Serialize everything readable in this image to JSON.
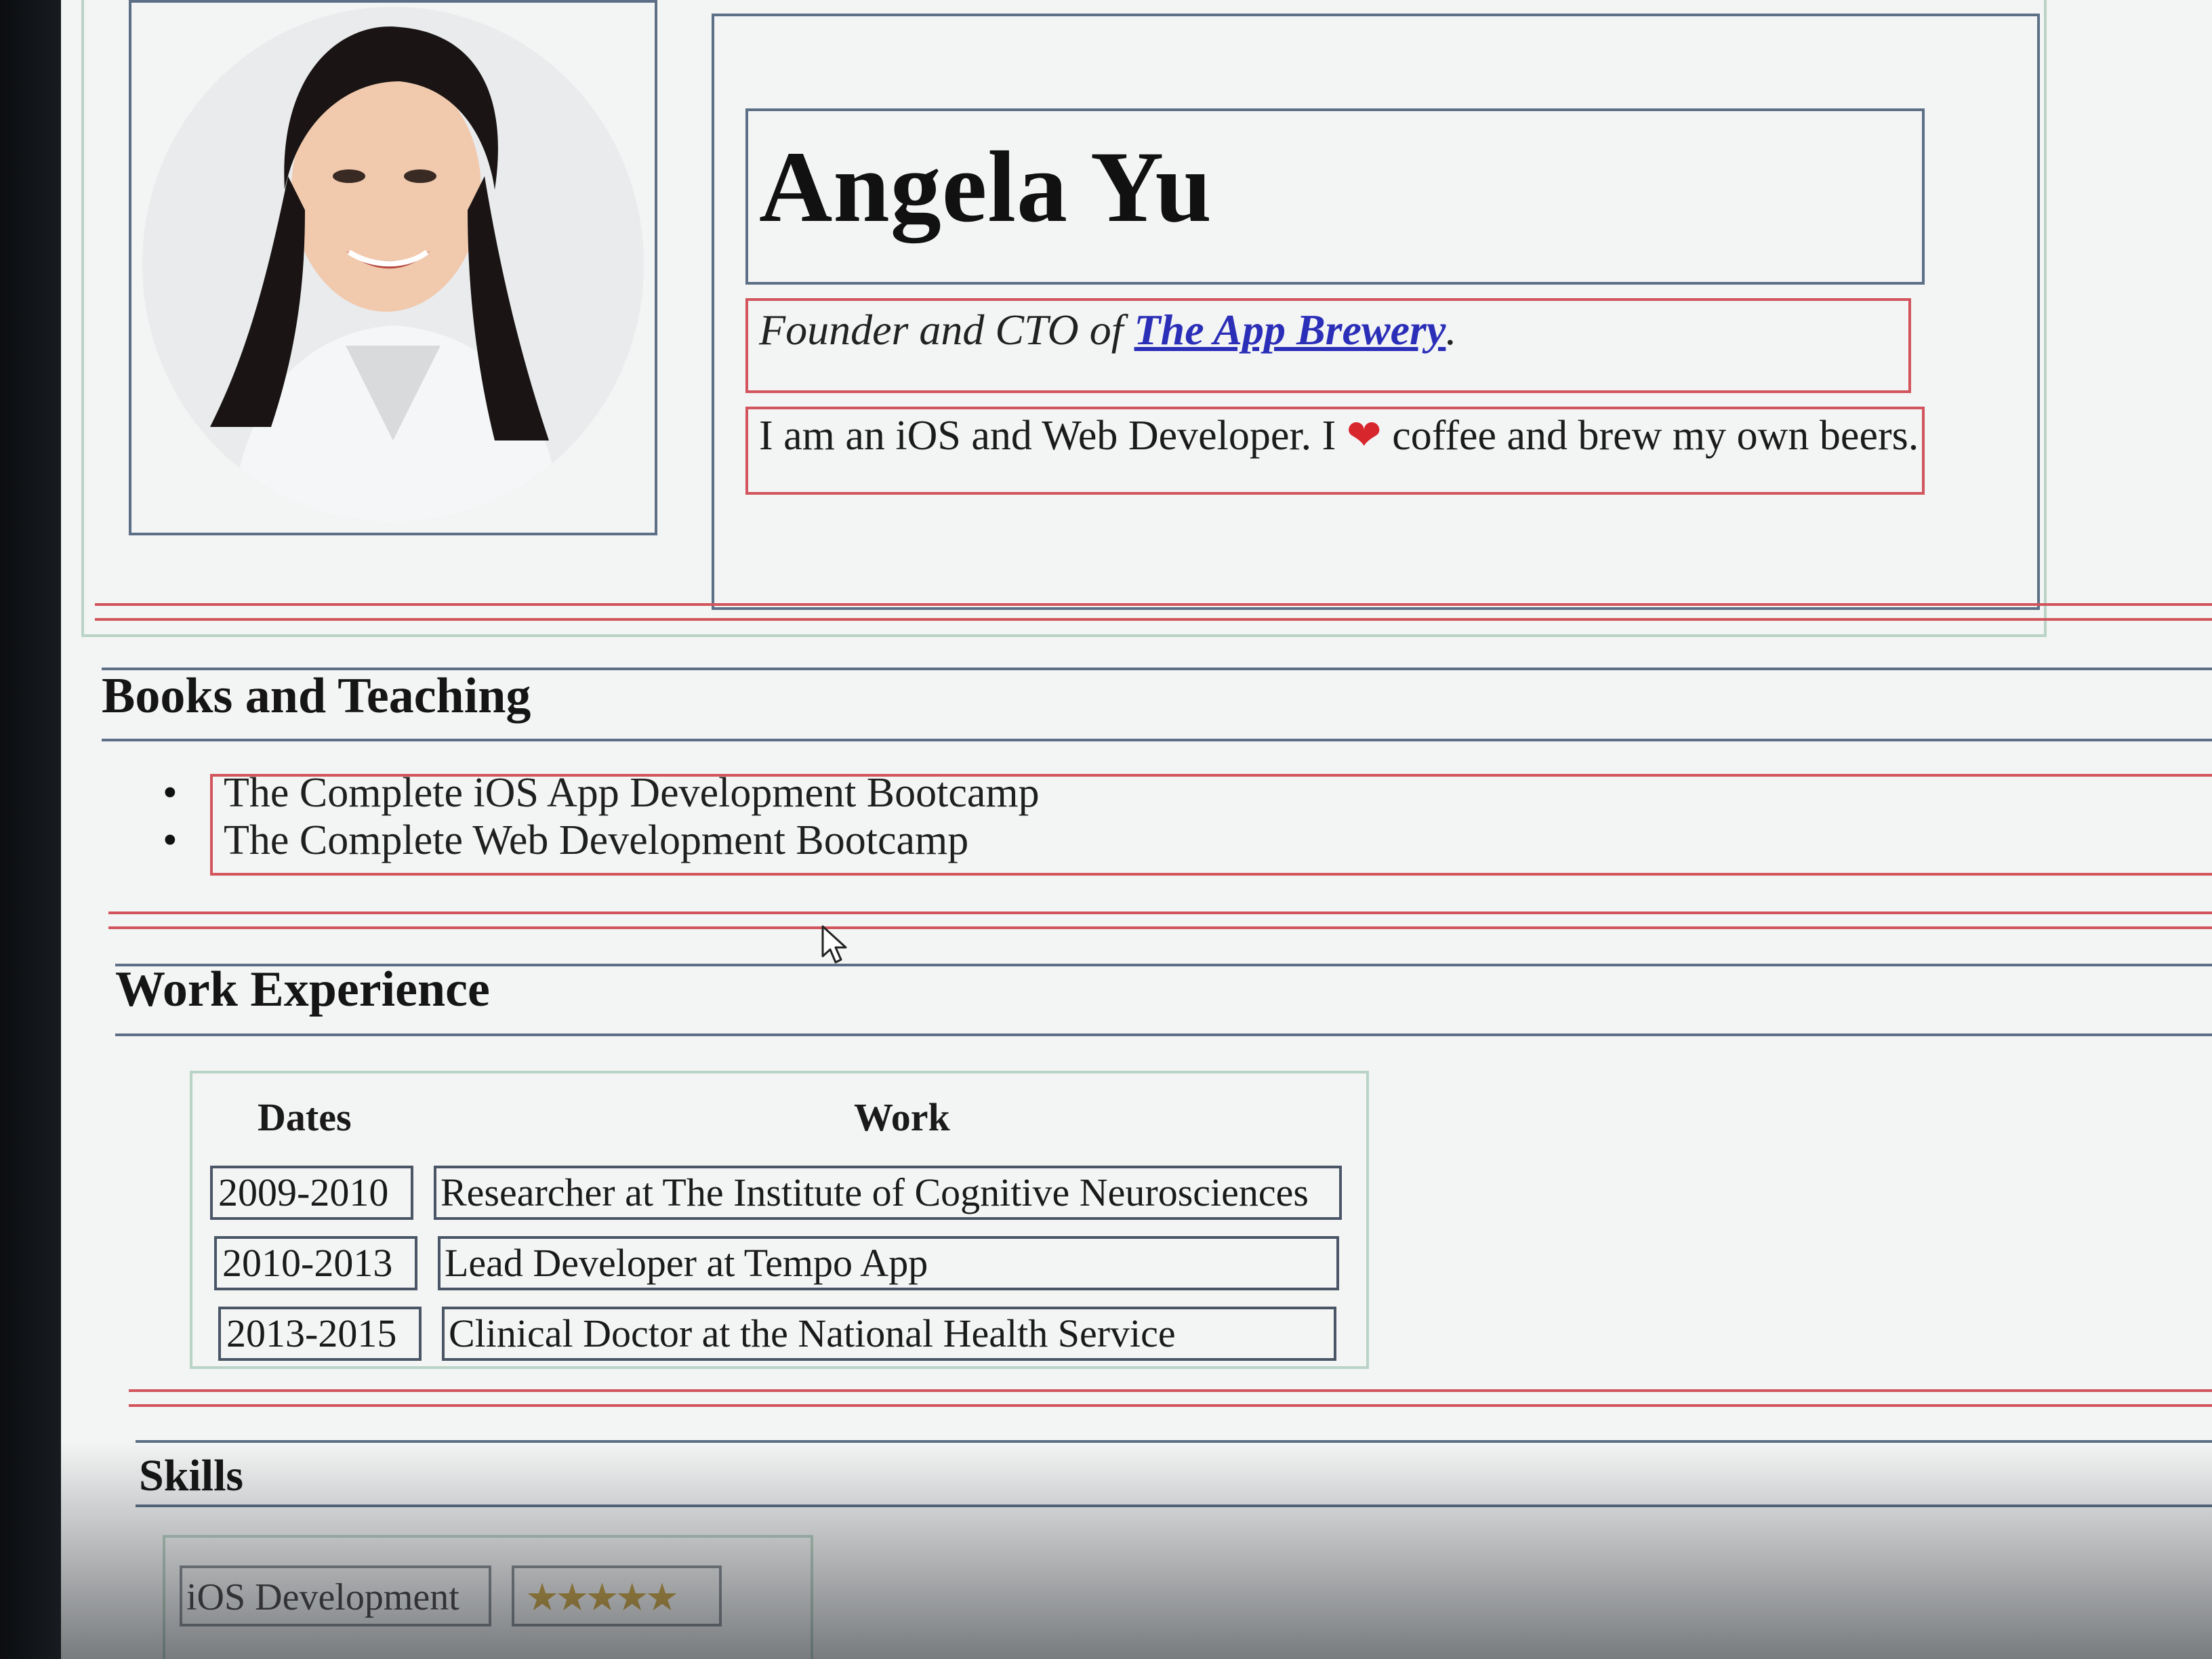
{
  "profile": {
    "name": "Angela Yu",
    "tagline_prefix": "Founder and CTO of ",
    "tagline_link": "The App Brewery",
    "tagline_suffix": ".",
    "bio_prefix": "I am an iOS and Web Developer. I ",
    "bio_suffix": " coffee and brew my own beers."
  },
  "books": {
    "heading": "Books and Teaching",
    "items": [
      "The Complete iOS App Development Bootcamp",
      "The Complete Web Development Bootcamp"
    ]
  },
  "work": {
    "heading": "Work Experience",
    "columns": [
      "Dates",
      "Work"
    ],
    "rows": [
      {
        "dates": "2009-2010",
        "work": "Researcher at The Institute of Cognitive Neurosciences"
      },
      {
        "dates": "2010-2013",
        "work": "Lead Developer at Tempo App"
      },
      {
        "dates": "2013-2015",
        "work": "Clinical Doctor at the National Health Service"
      }
    ]
  },
  "skills": {
    "heading": "Skills",
    "items": [
      {
        "name": "iOS Development",
        "stars": "★★★★★"
      }
    ]
  },
  "icons": {
    "heart": "heart-icon",
    "cursor": "mouse-pointer-icon"
  },
  "colors": {
    "link": "#2b2fb8",
    "heart": "#d8262d",
    "outline_red": "#d2545c",
    "outline_blue": "#5c6f86",
    "outline_green": "#b9d3c6"
  }
}
